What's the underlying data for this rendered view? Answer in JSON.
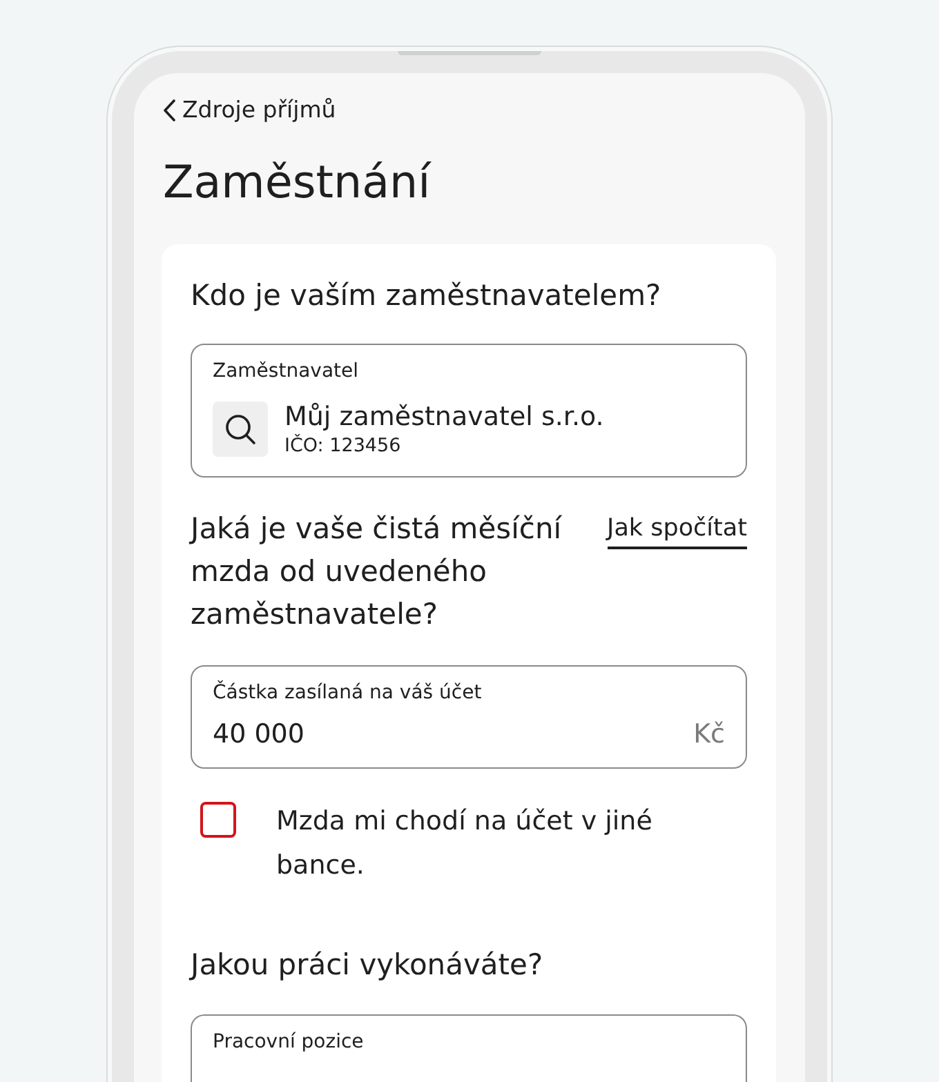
{
  "nav": {
    "back_label": "Zdroje příjmů"
  },
  "page_title": "Zaměstnání",
  "form": {
    "employer": {
      "question": "Kdo je vaším zaměstnavatelem?",
      "field": {
        "label": "Zaměstnavatel",
        "value": "Můj zaměstnavatel s.r.o.",
        "subvalue": "IČO: 123456"
      }
    },
    "salary": {
      "question": "Jaká je vaše čistá měsíční mzda od uvedeného zaměstnavatele?",
      "help_link": "Jak spočítat",
      "field": {
        "label": "Částka zasílaná na váš účet",
        "value": "40 000",
        "unit": "Kč"
      },
      "checkbox": {
        "label": "Mzda mi chodí na účet v jiné bance.",
        "checked": false
      }
    },
    "position": {
      "question": "Jakou práci vykonáváte?",
      "field": {
        "label": "Pracovní pozice"
      }
    }
  }
}
